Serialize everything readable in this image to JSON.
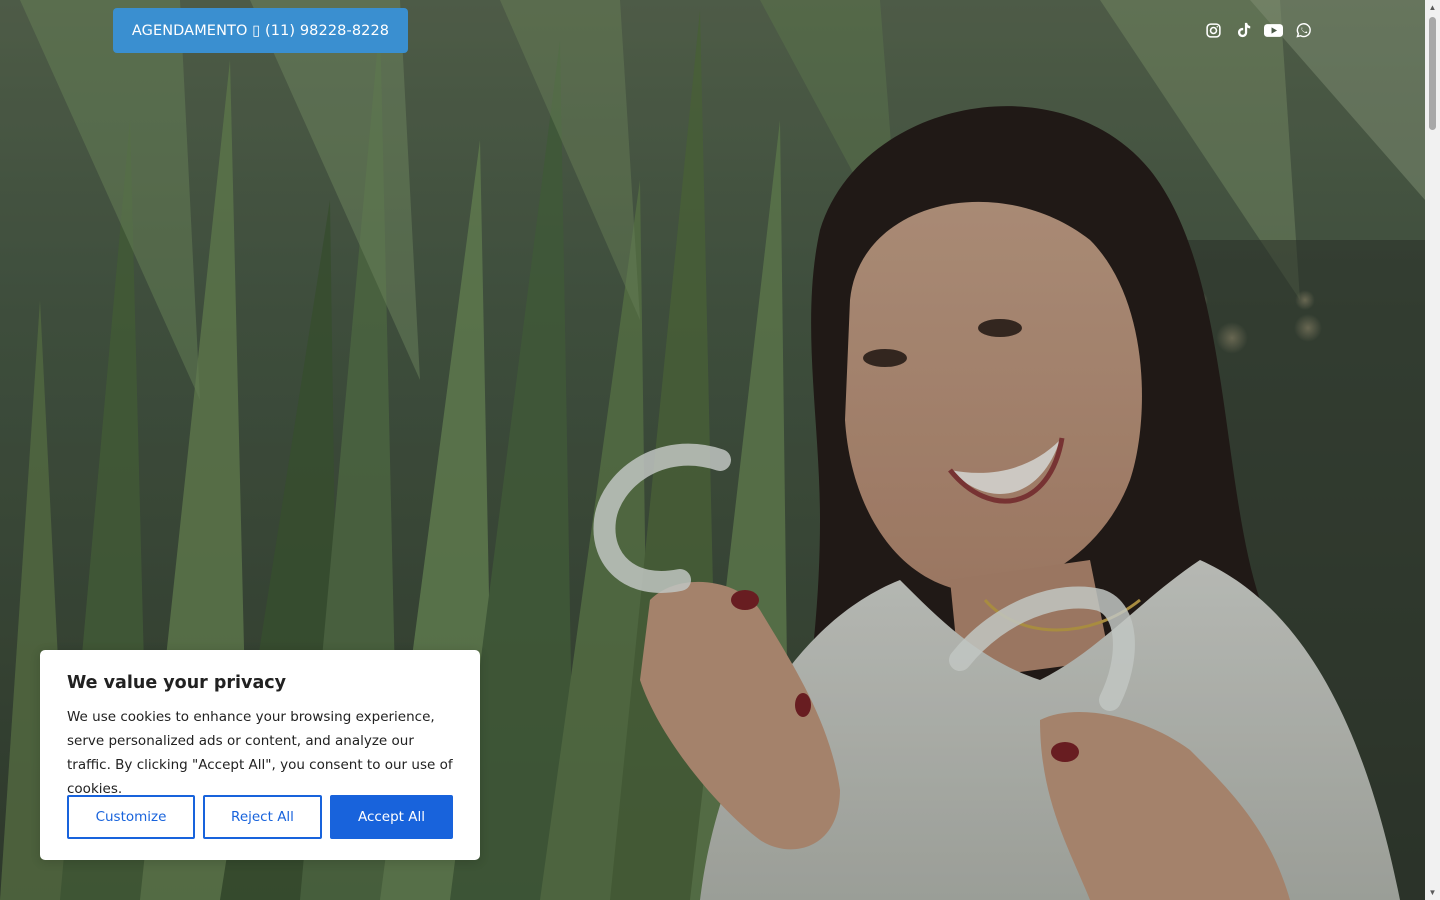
{
  "header": {
    "booking_button_label": "AGENDAMENTO ▯ (11) 98228-8228",
    "social_icons": [
      "instagram-icon",
      "tiktok-icon",
      "youtube-icon",
      "whatsapp-icon"
    ]
  },
  "hero": {
    "image_description_icon": "hero-photo"
  },
  "cookie_banner": {
    "title": "We value your privacy",
    "body": "We use cookies to enhance your browsing experience, serve personalized ads or content, and analyze our traffic. By clicking \"Accept All\", you consent to our use of cookies.",
    "customize_label": "Customize",
    "reject_label": "Reject All",
    "accept_label": "Accept All"
  },
  "colors": {
    "booking_button": "#3a8fd0",
    "cookie_primary": "#1863dc",
    "cookie_text": "#212121"
  }
}
